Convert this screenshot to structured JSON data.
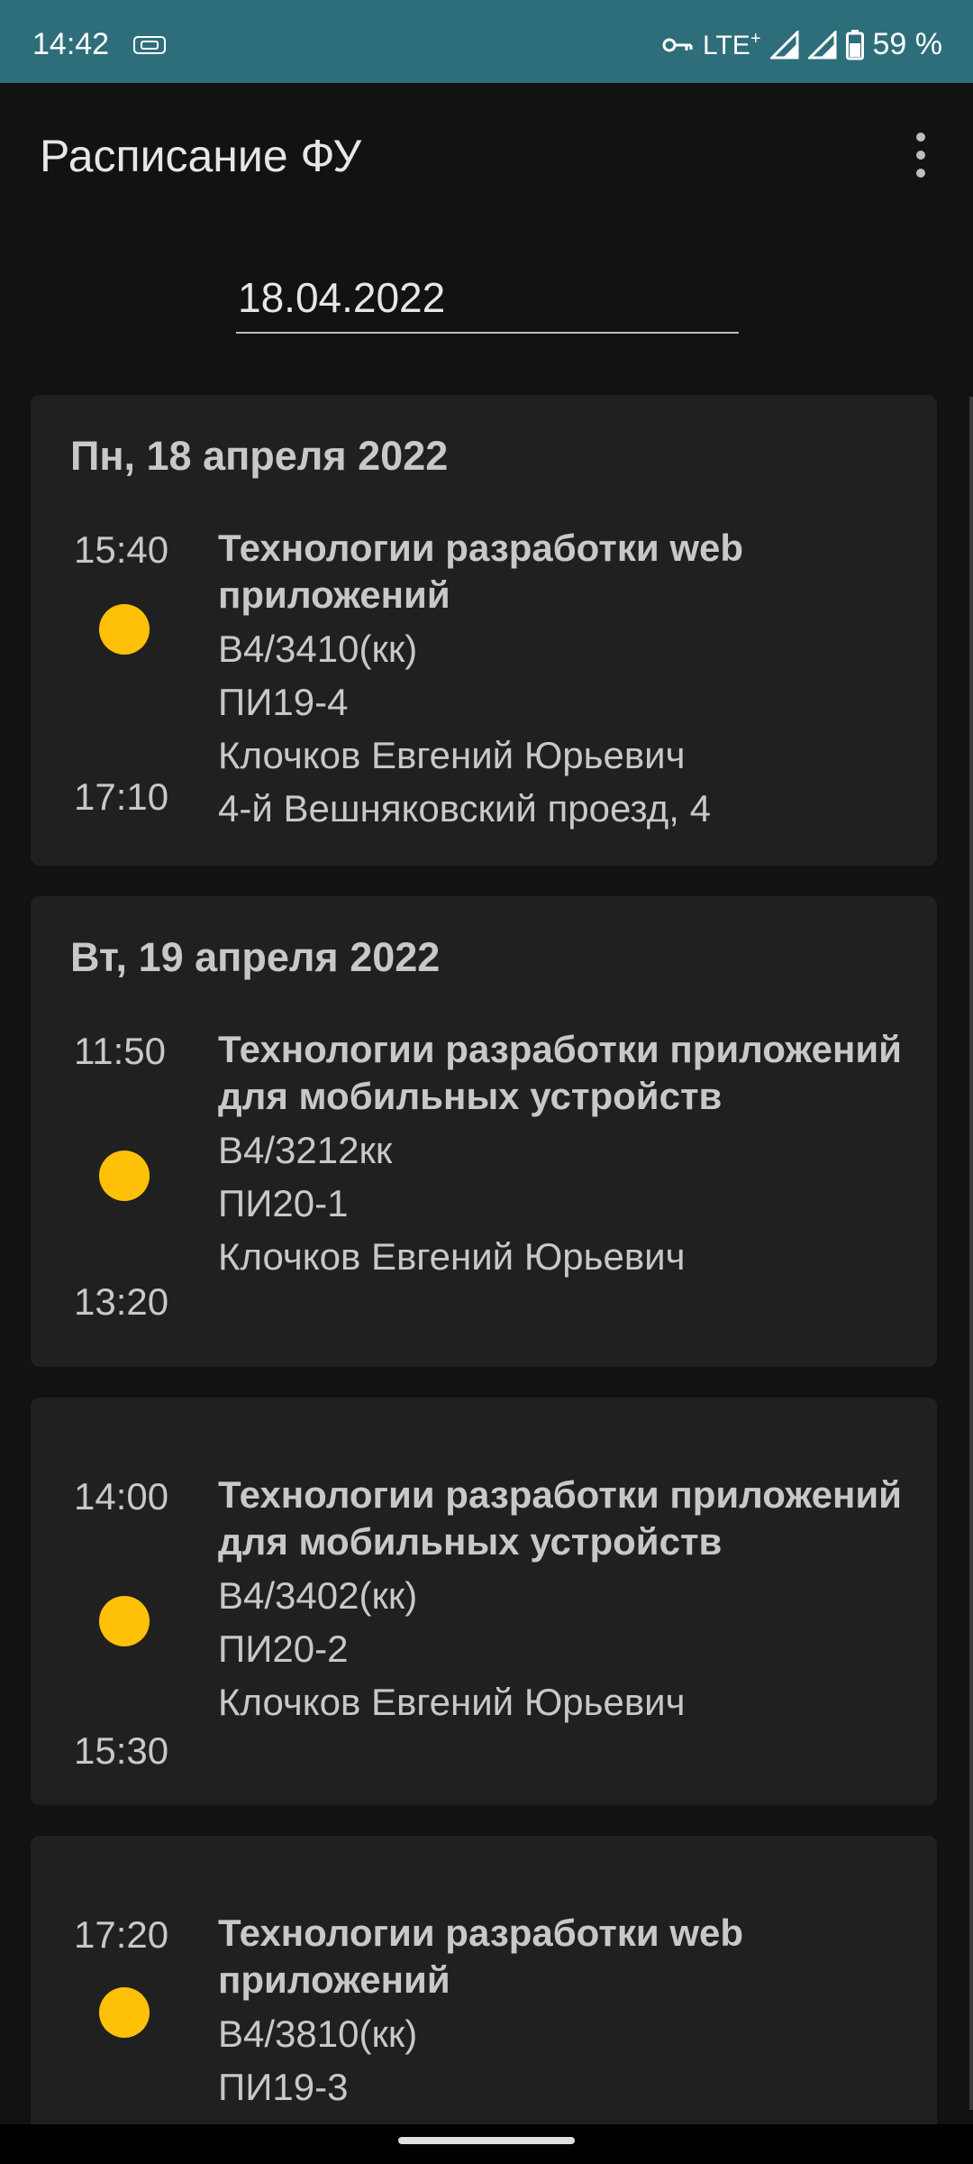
{
  "status_bar": {
    "time": "14:42",
    "network": "LTE",
    "network_suffix": "+",
    "battery": "59 %",
    "icons": [
      "sim-icon",
      "vpn-key-icon",
      "signal-icon",
      "signal-icon",
      "battery-icon"
    ]
  },
  "app_bar": {
    "title": "Расписание ФУ",
    "menu_icon": "more-vert-icon"
  },
  "date_input": {
    "value": "18.04.2022"
  },
  "accent_color": "#ffc107",
  "days": [
    {
      "header": "Пн, 18 апреля 2022",
      "lessons": [
        {
          "start": "15:40",
          "end": "17:10",
          "subject": "Технологии разработки web приложений",
          "room": "В4/3410(кк)",
          "group": "ПИ19-4",
          "teacher": "Клочков Евгений Юрьевич",
          "address": "4-й Вешняковский проезд, 4"
        }
      ]
    },
    {
      "header": "Вт, 19 апреля 2022",
      "lessons": [
        {
          "start": "11:50",
          "end": "13:20",
          "subject": "Технологии разработки приложений для мобильных устройств",
          "room": "В4/3212кк",
          "group": "ПИ20-1",
          "teacher": "Клочков Евгений Юрьевич"
        }
      ]
    },
    {
      "header": "",
      "lessons": [
        {
          "start": "14:00",
          "end": "15:30",
          "subject": "Технологии разработки приложений для мобильных устройств",
          "room": "В4/3402(кк)",
          "group": "ПИ20-2",
          "teacher": "Клочков Евгений Юрьевич"
        }
      ]
    },
    {
      "header": "",
      "lessons": [
        {
          "start": "17:20",
          "subject": "Технологии разработки web приложений",
          "room": "В4/3810(кк)",
          "group": "ПИ19-3"
        }
      ]
    }
  ]
}
